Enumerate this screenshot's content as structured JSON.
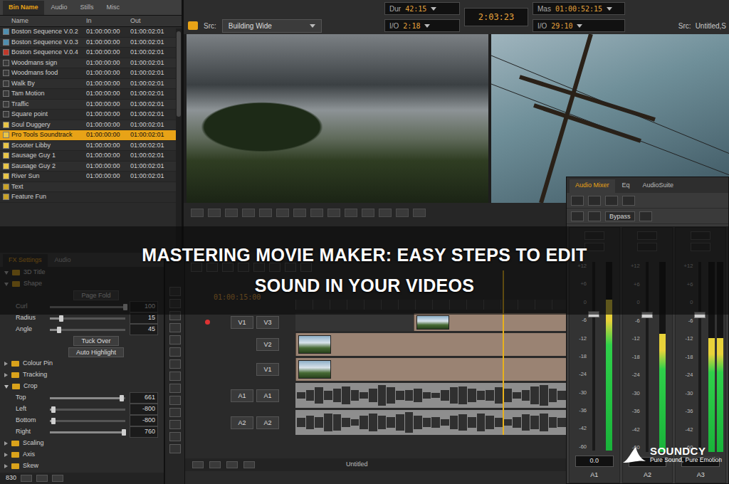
{
  "bin": {
    "tabs": [
      {
        "label": "Bin Name",
        "selected": true
      },
      {
        "label": "Audio",
        "selected": false
      },
      {
        "label": "Stills",
        "selected": false
      },
      {
        "label": "Misc",
        "selected": false
      }
    ],
    "columns": [
      "Name",
      "In",
      "Out"
    ],
    "rows": [
      {
        "name": "Boston Sequence V.0.2",
        "in": "01:00:00:00",
        "out": "01:00:02:01",
        "selected": false,
        "color": "#4f8fb0"
      },
      {
        "name": "Boston Sequence V.0.3",
        "in": "01:00:00:00",
        "out": "01:00:02:01",
        "selected": false,
        "color": "#4f8fb0"
      },
      {
        "name": "Boston Sequence V.0.4",
        "in": "01:00:00:00",
        "out": "01:00:02:01",
        "selected": false,
        "color": "#c0392b"
      },
      {
        "name": "Woodmans sign",
        "in": "01:00:00:00",
        "out": "01:00:02:01",
        "selected": false,
        "color": "#3a3a3a"
      },
      {
        "name": "Woodmans food",
        "in": "01:00:00:00",
        "out": "01:00:02:01",
        "selected": false,
        "color": "#3a3a3a"
      },
      {
        "name": "Walk By",
        "in": "01:00:00:00",
        "out": "01:00:02:01",
        "selected": false,
        "color": "#3a3a3a"
      },
      {
        "name": "Tam Motion",
        "in": "01:00:00:00",
        "out": "01:00:02:01",
        "selected": false,
        "color": "#3a3a3a"
      },
      {
        "name": "Traffic",
        "in": "01:00:00:00",
        "out": "01:00:02:01",
        "selected": false,
        "color": "#3a3a3a"
      },
      {
        "name": "Square point",
        "in": "01:00:00:00",
        "out": "01:00:02:01",
        "selected": false,
        "color": "#3a3a3a"
      },
      {
        "name": "Soul Duggery",
        "in": "01:00:00:00",
        "out": "01:00:02:01",
        "selected": false,
        "color": "#e8c547"
      },
      {
        "name": "Pro Tools Soundtrack",
        "in": "01:00:00:00",
        "out": "01:00:02:01",
        "selected": true,
        "color": "#e8c547"
      },
      {
        "name": "Scooter Libby",
        "in": "01:00:00:00",
        "out": "01:00:02:01",
        "selected": false,
        "color": "#e8c547"
      },
      {
        "name": "Sausage Guy 1",
        "in": "01:00:00:00",
        "out": "01:00:02:01",
        "selected": false,
        "color": "#e8c547"
      },
      {
        "name": "Sausage Guy 2",
        "in": "01:00:00:00",
        "out": "01:00:02:01",
        "selected": false,
        "color": "#e8c547"
      },
      {
        "name": "River Sun",
        "in": "01:00:00:00",
        "out": "01:00:02:01",
        "selected": false,
        "color": "#e8c547"
      },
      {
        "name": "Text",
        "in": "",
        "out": "",
        "selected": false,
        "color": "#c9a227"
      },
      {
        "name": "Feature Fun",
        "in": "",
        "out": "",
        "selected": false,
        "color": "#c9a227"
      }
    ]
  },
  "monitor": {
    "readouts": [
      {
        "label": "Dur",
        "value": "42:15"
      },
      {
        "label": "I/O",
        "value": "2:18"
      }
    ],
    "center": "2:03:23",
    "readouts2": [
      {
        "label": "Mas",
        "value": "01:00:52:15"
      },
      {
        "label": "I/O",
        "value": "29:10"
      }
    ],
    "source": {
      "label": "Src:",
      "value": "Building Wide"
    },
    "record": {
      "label": "Src:",
      "value": "Untitled,S"
    }
  },
  "fx": {
    "tabs": [
      {
        "label": "FX Settings",
        "selected": true
      },
      {
        "label": "Audio",
        "selected": false
      }
    ],
    "items": [
      {
        "kind": "group",
        "label": "3D Title",
        "expanded": true
      },
      {
        "kind": "group",
        "label": "Shape",
        "expanded": true
      },
      {
        "kind": "button",
        "label": "Page Fold"
      },
      {
        "kind": "param",
        "label": "Curl",
        "value": "100",
        "level": 1
      },
      {
        "kind": "param",
        "label": "Radius",
        "value": "15",
        "level": 0.15
      },
      {
        "kind": "param",
        "label": "Angle",
        "value": "45",
        "level": 0.12
      },
      {
        "kind": "button",
        "label": "Tuck Over"
      },
      {
        "kind": "button",
        "label": "Auto Highlight"
      },
      {
        "kind": "group",
        "label": "Colour Pin",
        "expanded": false
      },
      {
        "kind": "group",
        "label": "Tracking",
        "expanded": false
      },
      {
        "kind": "group",
        "label": "Crop",
        "expanded": true
      },
      {
        "kind": "param",
        "label": "Top",
        "value": "661",
        "level": 0.95
      },
      {
        "kind": "param",
        "label": "Left",
        "value": "-800",
        "level": 0.05
      },
      {
        "kind": "param",
        "label": "Bottom",
        "value": "-800",
        "level": 0.05
      },
      {
        "kind": "param",
        "label": "Right",
        "value": "760",
        "level": 0.98
      },
      {
        "kind": "group",
        "label": "Scaling",
        "expanded": false
      },
      {
        "kind": "group",
        "label": "Axis",
        "expanded": false
      },
      {
        "kind": "group",
        "label": "Skew",
        "expanded": false
      }
    ],
    "footer": "830"
  },
  "timeline": {
    "timecode": "01:00:15:00",
    "playhead": 0.48,
    "tracks": [
      {
        "name": "V3",
        "patch": "V1",
        "kind": "video",
        "locked": true,
        "segments": [
          {
            "kind": "gap",
            "length": 105
          },
          {
            "kind": "clip",
            "length": 158
          },
          {
            "kind": "gap",
            "length": 122
          }
        ]
      },
      {
        "name": "V2",
        "patch": "",
        "kind": "video",
        "locked": false,
        "segments": [
          {
            "kind": "clip",
            "length": 275
          },
          {
            "kind": "clip",
            "length": 110
          }
        ]
      },
      {
        "name": "V1",
        "patch": "",
        "kind": "video",
        "locked": false,
        "segments": [
          {
            "kind": "clip",
            "length": 275
          },
          {
            "kind": "clip",
            "length": 110
          }
        ]
      },
      {
        "name": "A1",
        "patch": "A1",
        "kind": "audio",
        "locked": false,
        "peaks": [
          0.3,
          0.5,
          0.7,
          0.4,
          0.6,
          0.8,
          0.5,
          0.3,
          0.6,
          0.9,
          0.7,
          0.4,
          0.5,
          0.6,
          0.3,
          0.2,
          0.5,
          0.7,
          0.8,
          0.6,
          0.4,
          0.5,
          0.7,
          0.6,
          0.3,
          0.5,
          0.8,
          0.9,
          0.6,
          0.4,
          0.3,
          0.5,
          0.6,
          0.7,
          0.5,
          0.3,
          0.6,
          0.8,
          0.7,
          0.5,
          0.4,
          0.6,
          0.7,
          0.5,
          0.4,
          0.6,
          0.5,
          0.3
        ]
      },
      {
        "name": "A2",
        "patch": "A2",
        "kind": "audio",
        "locked": false,
        "peaks": [
          0.4,
          0.6,
          0.5,
          0.8,
          0.7,
          0.4,
          0.3,
          0.6,
          0.8,
          0.6,
          0.5,
          0.7,
          0.9,
          0.6,
          0.4,
          0.5,
          0.3,
          0.6,
          0.7,
          0.5,
          0.8,
          0.6,
          0.4,
          0.3,
          0.5,
          0.7,
          0.6,
          0.8,
          0.5,
          0.4,
          0.6,
          0.7,
          0.9,
          0.6,
          0.4,
          0.5,
          0.3,
          0.6,
          0.7,
          0.8,
          0.5,
          0.4,
          0.6,
          0.5,
          0.7,
          0.4,
          0.3,
          0.5
        ]
      }
    ],
    "footer": "Untitled"
  },
  "mixer": {
    "tabs": [
      {
        "label": "Audio Mixer",
        "selected": true
      },
      {
        "label": "Eq",
        "selected": false
      },
      {
        "label": "AudioSuite",
        "selected": false
      }
    ],
    "bypass": "Bypass",
    "scale": [
      "+12",
      "+6",
      "0",
      "-6",
      "-12",
      "-18",
      "-24",
      "-30",
      "-36",
      "-42",
      "-60"
    ],
    "channels": [
      {
        "name": "A1",
        "reading": "0.0",
        "fader": 0.72,
        "levels": [
          0.8
        ]
      },
      {
        "name": "A2",
        "reading": "",
        "fader": 0.72,
        "levels": [
          0.62
        ]
      },
      {
        "name": "A3",
        "reading": "",
        "fader": 0.72,
        "levels": [
          0.6,
          0.6
        ]
      }
    ]
  },
  "banner": {
    "lines": [
      "MASTERING MOVIE MAKER: EASY STEPS TO EDIT",
      "SOUND IN YOUR VIDEOS"
    ]
  },
  "brand": {
    "name": "SOUNDCY",
    "tagline": "Pure Sound, Pure Emotion"
  }
}
